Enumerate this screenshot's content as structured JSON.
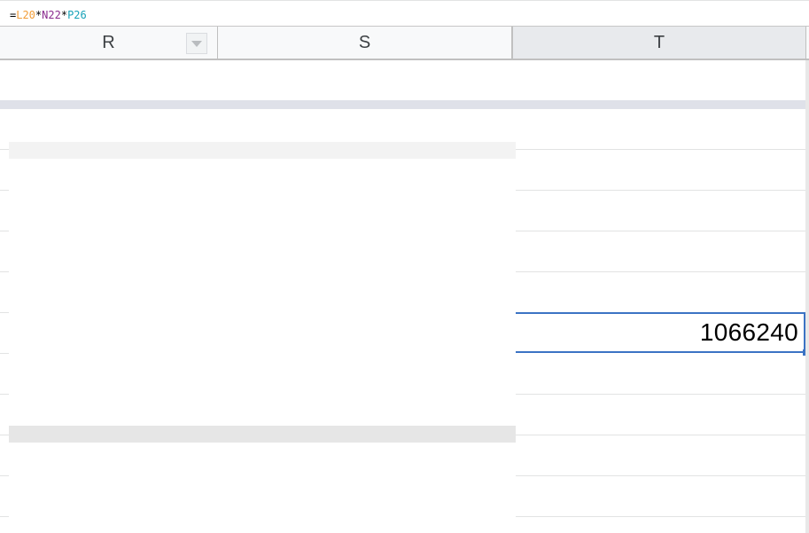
{
  "formula_bar": {
    "prefix": "=",
    "ref1": "L20",
    "op1": "*",
    "ref2": "N22",
    "op2": "*",
    "ref3": "P26",
    "colors": {
      "ref1": "#f29d38",
      "ref2": "#8a2c8f",
      "ref3": "#17a2b8"
    }
  },
  "columns": [
    {
      "label": "R",
      "has_filter": true
    },
    {
      "label": "S"
    },
    {
      "label": "T",
      "selected": true
    }
  ],
  "selected_cell": {
    "column": "T",
    "value": "1066240"
  },
  "colors": {
    "selection": "#3b73c4",
    "header_bg": "#f8f9fa",
    "selected_header_bg": "#e8eaed",
    "gridline": "#e2e3e3"
  }
}
